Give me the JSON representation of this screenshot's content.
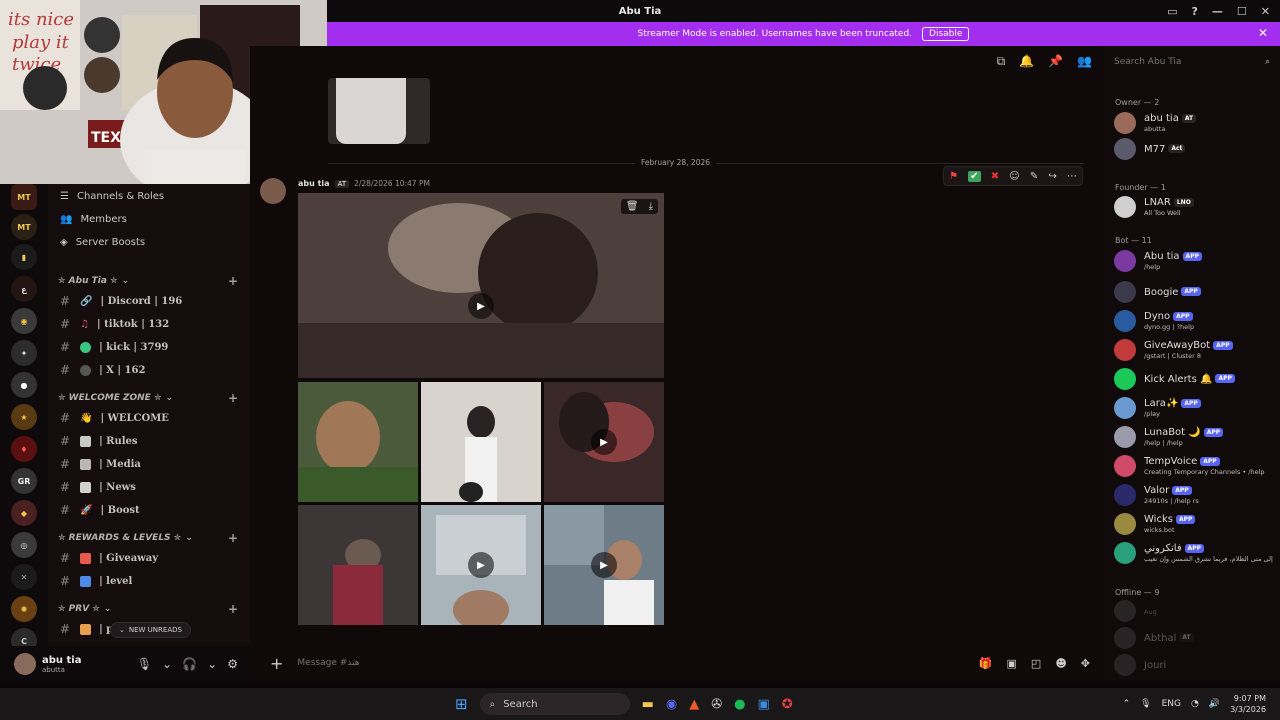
{
  "window": {
    "title": "Abu Tia"
  },
  "streamer_banner": {
    "text": "Streamer Mode is enabled. Usernames have been truncated.",
    "button": "Disable"
  },
  "search": {
    "placeholder": "Search Abu Tia"
  },
  "nav": [
    {
      "label": "Channels & Roles"
    },
    {
      "label": "Members"
    },
    {
      "label": "Server Boosts"
    }
  ],
  "categories": [
    {
      "name": "✮ Abu Tia ✮",
      "channels": [
        {
          "label": "| Discord | 196"
        },
        {
          "label": "| tiktok | 132"
        },
        {
          "label": "| kick | 3799"
        },
        {
          "label": "| X | 162"
        }
      ]
    },
    {
      "name": "✮ WELCOME ZONE ✮",
      "channels": [
        {
          "label": "| WELCOME"
        },
        {
          "label": "| Rules"
        },
        {
          "label": "| Media"
        },
        {
          "label": "| News"
        },
        {
          "label": "| Boost"
        }
      ]
    },
    {
      "name": "✮ REWARDS & LEVELS ✮",
      "channels": [
        {
          "label": "| Giveaway"
        },
        {
          "label": "| level"
        }
      ]
    },
    {
      "name": "✮ PRV ✮",
      "channels": [
        {
          "label": "| p"
        }
      ]
    }
  ],
  "new_unreads": "NEW UNREADS",
  "user": {
    "name": "abu tia",
    "status": "abutta"
  },
  "message": {
    "date_divider": "February 28, 2026",
    "author": "abu tia",
    "tag": "AT",
    "timestamp": "2/28/2026 10:47 PM"
  },
  "composer": {
    "placeholder": "Message #هند"
  },
  "members": {
    "groups": [
      {
        "label": "Owner — 2",
        "items": [
          {
            "name": "abu tia",
            "sub": "abutta",
            "tag": "AT"
          },
          {
            "name": "M77",
            "sub": "",
            "tag": "Act"
          }
        ]
      },
      {
        "label": "Founder — 1",
        "items": [
          {
            "name": "LNAR",
            "sub": "All Too Well",
            "tag": "LNO"
          }
        ]
      },
      {
        "label": "Bot — 11",
        "items": [
          {
            "name": "Abu tia",
            "sub": "/help",
            "tag": "APP"
          },
          {
            "name": "Boogie",
            "sub": "",
            "tag": "APP"
          },
          {
            "name": "Dyno",
            "sub": "dyno.gg | ?help",
            "tag": "APP"
          },
          {
            "name": "GiveAwayBot",
            "sub": "/gstart | Cluster 8",
            "tag": "APP"
          },
          {
            "name": "Kick Alerts 🔔",
            "sub": "",
            "tag": "APP"
          },
          {
            "name": "Lara✨",
            "sub": "/play",
            "tag": "APP"
          },
          {
            "name": "LunaBot 🌙",
            "sub": "/help | /help",
            "tag": "APP"
          },
          {
            "name": "TempVoice",
            "sub": "Creating Temporary Channels • /help",
            "tag": "APP"
          },
          {
            "name": "Valor",
            "sub": "24910s | /help rs",
            "tag": "APP"
          },
          {
            "name": "Wicks",
            "sub": "wicks.bot",
            "tag": "APP"
          },
          {
            "name": "فاتكروني",
            "sub": "إلى متى الظلام، فربما تشرق الشمس وإن تغيب",
            "tag": "APP"
          }
        ]
      },
      {
        "label": "Offline — 9",
        "items": [
          {
            "name": "",
            "sub": "Aug",
            "tag": ""
          },
          {
            "name": "Abthal",
            "sub": "",
            "tag": "AT"
          },
          {
            "name": "Jouri",
            "sub": "",
            "tag": ""
          }
        ]
      }
    ]
  },
  "taskbar": {
    "search": "Search",
    "lang": "ENG",
    "time": "9:07 PM",
    "date": "3/3/2026"
  },
  "colors": {
    "accent": "#a42ef0",
    "blurple": "#5865f2",
    "bg": "#0f090a"
  }
}
